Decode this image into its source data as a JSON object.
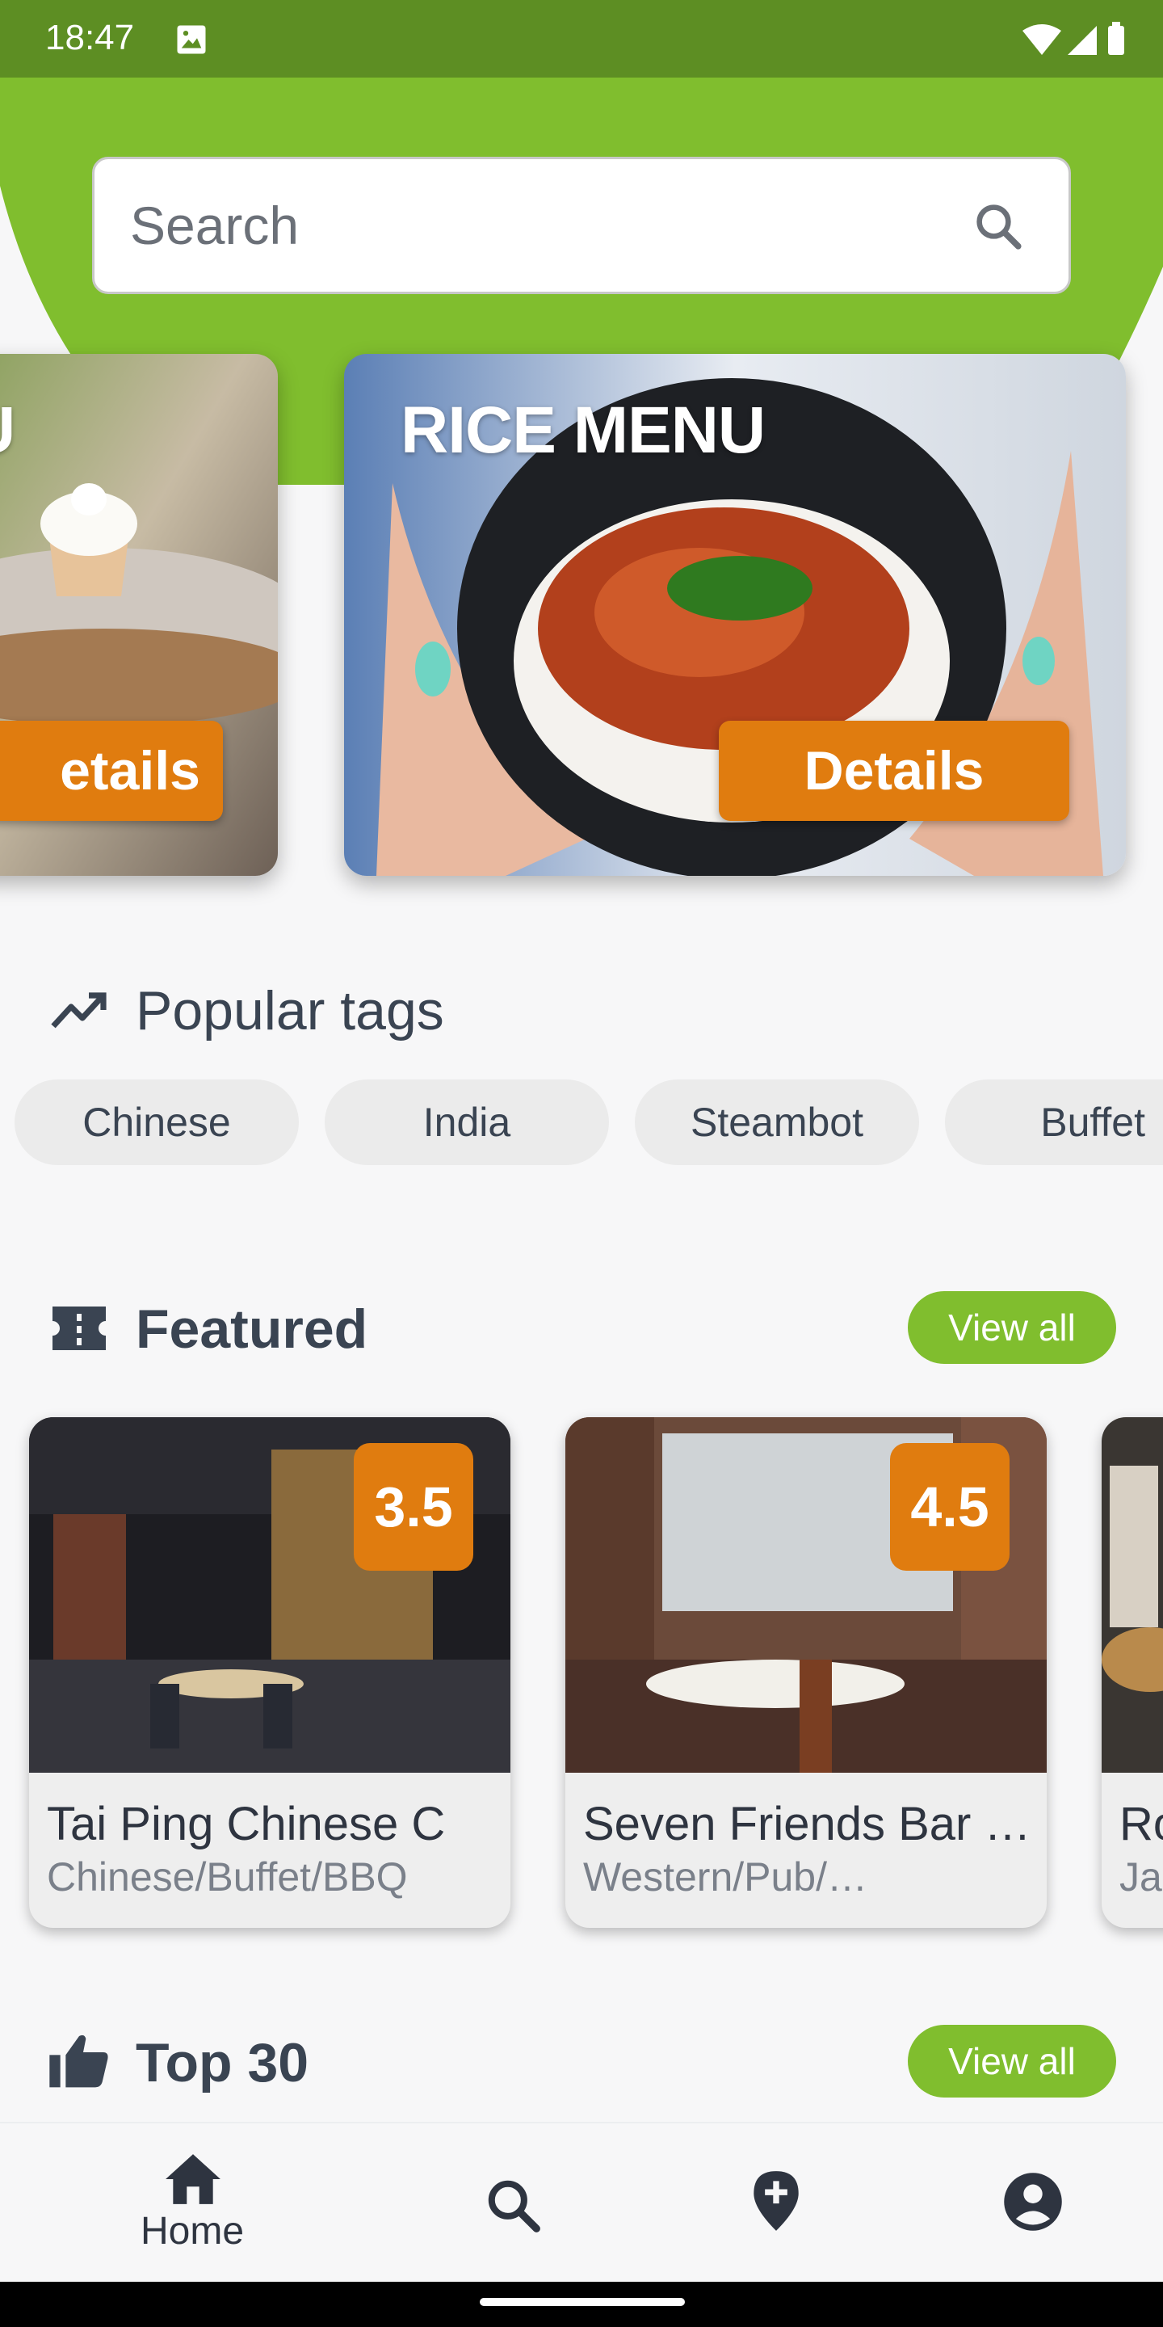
{
  "status_bar": {
    "time": "18:47"
  },
  "search": {
    "placeholder": "Search"
  },
  "carousel": {
    "cards": [
      {
        "title": "U",
        "details_label": "etails"
      },
      {
        "title": "RICE MENU",
        "details_label": "Details"
      }
    ]
  },
  "popular_tags": {
    "title": "Popular tags",
    "tags": [
      "Chinese",
      "India",
      "Steambot",
      "Buffet"
    ]
  },
  "featured": {
    "title": "Featured",
    "view_all": "View all",
    "restaurants": [
      {
        "name": "Tai Ping Chinese C",
        "categories": "Chinese/Buffet/BBQ",
        "rating": "3.5"
      },
      {
        "name": "Seven Friends Bar …",
        "categories": "Western/Pub/…",
        "rating": "4.5"
      },
      {
        "name": "Ro",
        "categories": "Ja",
        "rating": ""
      }
    ]
  },
  "top30": {
    "title": "Top 30",
    "view_all": "View all"
  },
  "bottom_nav": {
    "home_label": "Home"
  },
  "colors": {
    "green": "#80be2e",
    "status_green": "#5d8e23",
    "orange": "#e07c0f"
  }
}
